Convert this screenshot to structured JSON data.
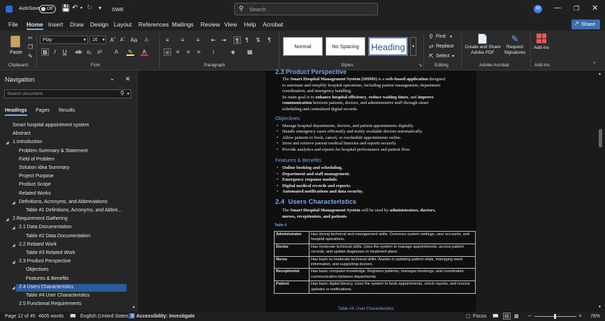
{
  "titlebar": {
    "autosave_label": "AutoSave",
    "autosave_state": "Off",
    "doc_name": "SWE",
    "search_placeholder": "Search",
    "avatar_initial": "M"
  },
  "menu": {
    "tabs": [
      "File",
      "Home",
      "Insert",
      "Draw",
      "Design",
      "Layout",
      "References",
      "Mailings",
      "Review",
      "View",
      "Help",
      "Acrobat"
    ],
    "active": "Home",
    "share_label": "Share"
  },
  "ribbon": {
    "paste_label": "Paste",
    "clipboard_label": "Clipboard",
    "font_name": "Play",
    "font_size": "16",
    "font_label": "Font",
    "paragraph_label": "Paragraph",
    "styles": [
      "Normal",
      "No Spacing",
      "Heading"
    ],
    "styles_label": "Styles",
    "find_label": "Find",
    "replace_label": "Replace",
    "select_label": "Select",
    "editing_label": "Editing",
    "create_share_label": "Create and Share Adobe PDF",
    "request_sig_label": "Request Signatures",
    "adobe_label": "Adobe Acrobat",
    "addins_label": "Add-ins",
    "addins_group_label": "Add-ins"
  },
  "navigation": {
    "title": "Navigation",
    "search_placeholder": "Search document",
    "tabs": [
      "Headings",
      "Pages",
      "Results"
    ],
    "items": [
      {
        "label": "Smart hospital appointment system",
        "level": 0,
        "expander": false
      },
      {
        "label": "Abstract",
        "level": 0,
        "expander": false
      },
      {
        "label": "1.Introduction",
        "level": 0,
        "expander": true
      },
      {
        "label": "Problem Summary & Statement",
        "level": 1,
        "expander": false
      },
      {
        "label": "Field of Problem",
        "level": 1,
        "expander": false
      },
      {
        "label": "Solution idea Summary",
        "level": 1,
        "expander": false
      },
      {
        "label": "Project Purpose",
        "level": 1,
        "expander": false
      },
      {
        "label": "Product Scope",
        "level": 1,
        "expander": false
      },
      {
        "label": "Related Works",
        "level": 1,
        "expander": false
      },
      {
        "label": "Definitions, Acronyms, and Abbreviations",
        "level": 1,
        "expander": true
      },
      {
        "label": "Table #1 Definitions, Acronyms, and Abbre...",
        "level": 2,
        "expander": false
      },
      {
        "label": "2.Requirement Gathering",
        "level": 0,
        "expander": true
      },
      {
        "label": "2.1  Data Documentation",
        "level": 1,
        "expander": true
      },
      {
        "label": "Table #2  Data Documentation",
        "level": 2,
        "expander": false
      },
      {
        "label": "2.2  Related Work",
        "level": 1,
        "expander": true
      },
      {
        "label": "Table #3  Related Work",
        "level": 2,
        "expander": false
      },
      {
        "label": "2.3  Product Perspective",
        "level": 1,
        "expander": true
      },
      {
        "label": "Objectives",
        "level": 2,
        "expander": false
      },
      {
        "label": "Features & Benefits",
        "level": 2,
        "expander": false
      },
      {
        "label": "2.4  Users Characteristics",
        "level": 1,
        "expander": true,
        "selected": true
      },
      {
        "label": "Table #4  User Characteristics",
        "level": 2,
        "expander": false
      },
      {
        "label": "2.5  Functional Requirements",
        "level": 1,
        "expander": false
      }
    ]
  },
  "document": {
    "h23": "2.3  Product Perspective",
    "p1": [
      [
        {
          "t": "The ",
          "b": false
        },
        {
          "t": "Smart Hospital Management System (SHMS)",
          "b": true
        },
        {
          "t": " is a ",
          "b": false
        },
        {
          "t": "web-based application",
          "b": true
        },
        {
          "t": " designed",
          "b": false
        }
      ],
      [
        {
          "t": "to automate and simplify hospital operations, including patient management, department",
          "b": false
        }
      ],
      [
        {
          "t": "coordination, and emergency handling.",
          "b": false
        }
      ],
      [
        {
          "t": "Its main goal is to ",
          "b": false
        },
        {
          "t": "enhance hospital efficiency",
          "b": true
        },
        {
          "t": ", ",
          "b": false
        },
        {
          "t": "reduce waiting times",
          "b": true
        },
        {
          "t": ", and ",
          "b": false
        },
        {
          "t": "improve",
          "b": true
        }
      ],
      [
        {
          "t": "communication",
          "b": true
        },
        {
          "t": " between patients, doctors, and administrative staff through smart",
          "b": false
        }
      ],
      [
        {
          "t": "scheduling and centralized digital records.",
          "b": false
        }
      ]
    ],
    "objectives_title": "Objectives",
    "objectives": [
      "Manage hospital departments, doctors, and patient appointments digitally.",
      "Handle emergency cases efficiently and notify available doctors automatically.",
      "Allow patients to book, cancel, or reschedule appointments online.",
      "Store and retrieve patient medical histories and reports securely.",
      "Provide analytics and reports for hospital performance and patient flow."
    ],
    "features_title": "Features & Benefits",
    "features": [
      "Online booking and scheduling.",
      "Department and staff management.",
      "Emergency response module.",
      "Digital medical records and reports.",
      "Automated notifications and data security."
    ],
    "h24_num": "2.4",
    "h24_title": "Users Characteristics",
    "p2": [
      [
        {
          "t": "The ",
          "b": false
        },
        {
          "t": "Smart Hospital Management System",
          "b": true
        },
        {
          "t": " will be used by ",
          "b": false
        },
        {
          "t": "administrators, doctors,",
          "b": true
        }
      ],
      [
        {
          "t": "nurses, receptionists, and patients",
          "b": true
        },
        {
          "t": ".",
          "b": false
        }
      ]
    ],
    "table_label": "Table 4",
    "table_rows": [
      {
        "role": "Administrator",
        "desc": "Has strong technical and management skills. Oversees system settings, user accounts, and hospital operations."
      },
      {
        "role": "Doctor",
        "desc": "Has moderate technical skills. Uses the system to manage appointments, access patient records, and update diagnoses or treatment plans."
      },
      {
        "role": "Nurse",
        "desc": "Has basic to moderate technical skills. Assists in updating patient vitals, managing ward information, and supporting doctors."
      },
      {
        "role": "Receptionist",
        "desc": "Has basic computer knowledge. Registers patients, manages bookings, and coordinates communication between departments."
      },
      {
        "role": "Patient",
        "desc": "Has basic digital literacy. Uses the system to book appointments, check reports, and receive updates or notifications."
      }
    ],
    "table_caption": "Table #4. User Characteristics"
  },
  "status": {
    "page": "Page 12 of 45",
    "words": "4605 words",
    "language": "English (United States)",
    "accessibility": "Accessibility: Investigate",
    "focus": "Focus",
    "zoom": "76%"
  },
  "colors": {
    "accent": "#6ea8ff",
    "heading": "#7aa6e8",
    "selected_nav": "#2d5a9b"
  }
}
